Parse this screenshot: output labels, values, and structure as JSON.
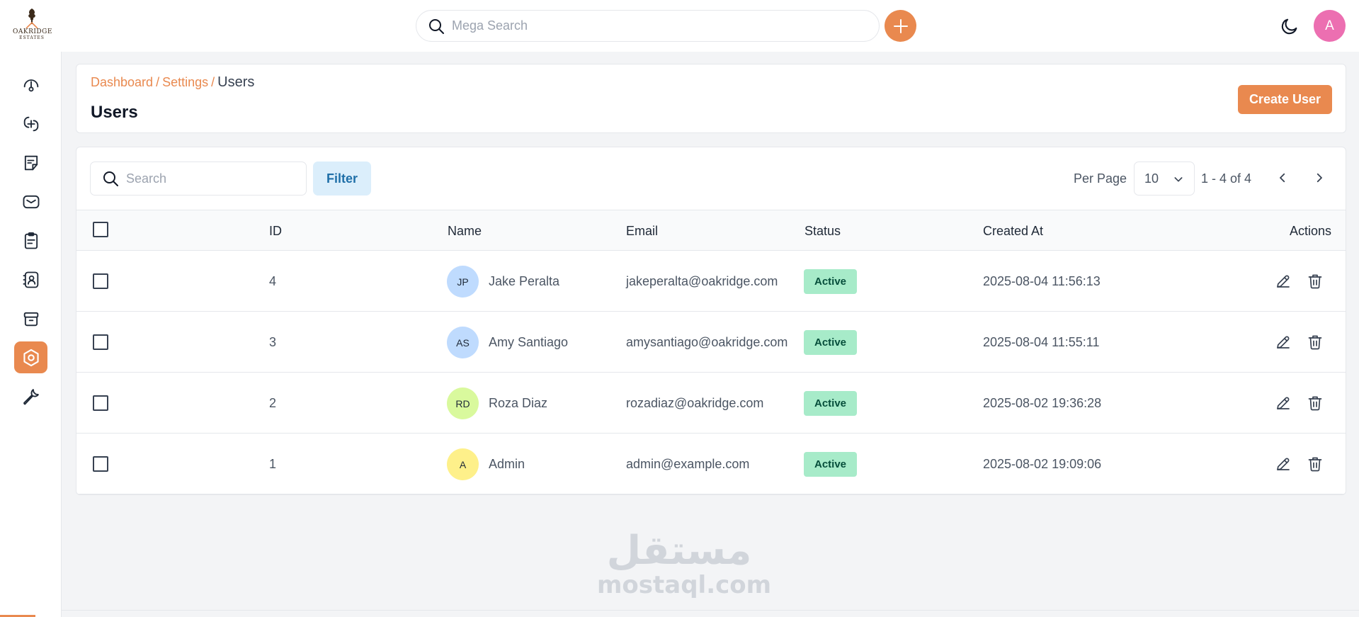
{
  "brand": {
    "logo_text": "OAKRIDGE",
    "logo_sub": "ESTATES"
  },
  "topbar": {
    "search_placeholder": "Mega Search",
    "avatar_initial": "A",
    "accent": "#e9894f",
    "avatar_color": "#ec6fb1"
  },
  "sidebar": {
    "items": [
      {
        "icon": "dashboard-gauge-icon",
        "active": false
      },
      {
        "icon": "integrations-icon",
        "active": false
      },
      {
        "icon": "notes-icon",
        "active": false
      },
      {
        "icon": "inbox-icon",
        "active": false
      },
      {
        "icon": "clipboard-icon",
        "active": false
      },
      {
        "icon": "contacts-icon",
        "active": false
      },
      {
        "icon": "archive-icon",
        "active": false
      },
      {
        "icon": "settings-icon",
        "active": true
      },
      {
        "icon": "wrench-icon",
        "active": false
      }
    ]
  },
  "header": {
    "breadcrumb": [
      "Dashboard",
      "Settings",
      "Users"
    ],
    "separator": "/",
    "title": "Users",
    "create_label": "Create User"
  },
  "toolbar": {
    "search_placeholder": "Search",
    "filter_label": "Filter",
    "per_page_label": "Per Page",
    "per_page_value": "10",
    "range_text": "1 - 4 of 4"
  },
  "table": {
    "columns": [
      "ID",
      "Name",
      "Email",
      "Status",
      "Created At",
      "Actions"
    ],
    "rows": [
      {
        "id": "4",
        "initials": "JP",
        "avatar_color": "#bfdbfe",
        "name": "Jake Peralta",
        "email": "jakeperalta@oakridge.com",
        "status": "Active",
        "created_at": "2025-08-04 11:56:13"
      },
      {
        "id": "3",
        "initials": "AS",
        "avatar_color": "#bfdbfe",
        "name": "Amy Santiago",
        "email": "amysantiago@oakridge.com",
        "status": "Active",
        "created_at": "2025-08-04 11:55:11"
      },
      {
        "id": "2",
        "initials": "RD",
        "avatar_color": "#d9f99d",
        "name": "Roza Diaz",
        "email": "rozadiaz@oakridge.com",
        "status": "Active",
        "created_at": "2025-08-02 19:36:28"
      },
      {
        "id": "1",
        "initials": "A",
        "avatar_color": "#fef08a",
        "name": "Admin",
        "email": "admin@example.com",
        "status": "Active",
        "created_at": "2025-08-02 19:09:06"
      }
    ]
  },
  "watermark": {
    "arabic": "مستقل",
    "latin": "mostaql.com"
  }
}
